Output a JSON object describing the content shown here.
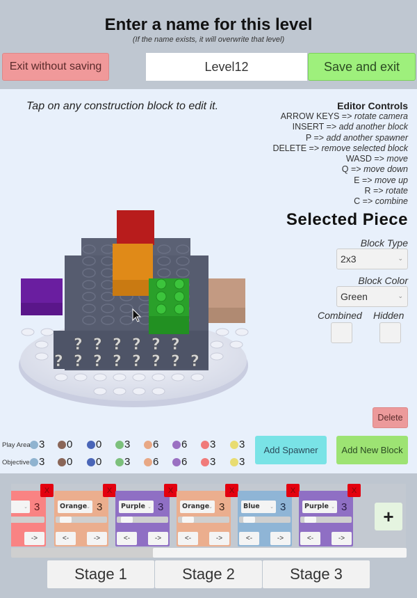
{
  "header": {
    "title": "Enter a name for this level",
    "subtitle": "(If the name exists, it will overwrite that level)",
    "exit_label": "Exit without saving",
    "level_name": "Level12",
    "save_label": "Save and exit"
  },
  "hint": "Tap on any construction block to edit it.",
  "controls": {
    "title": "Editor Controls",
    "items": [
      {
        "key": "ARROW KEYS =>",
        "action": "rotate camera"
      },
      {
        "key": "INSERT  =>",
        "action": "add another block"
      },
      {
        "key": "P =>",
        "action": "add another spawner"
      },
      {
        "key": "DELETE =>",
        "action": "remove selected block"
      },
      {
        "key": "WASD =>",
        "action": "move"
      },
      {
        "key": "Q =>",
        "action": "move down"
      },
      {
        "key": "E =>",
        "action": "move up"
      },
      {
        "key": "R =>",
        "action": "rotate"
      },
      {
        "key": "C =>",
        "action": "combine"
      }
    ]
  },
  "selected_piece": {
    "title": "Selected Piece",
    "block_type_label": "Block Type",
    "block_type": "2x3",
    "block_color_label": "Block Color",
    "block_color": "Green",
    "combined_label": "Combined",
    "hidden_label": "Hidden",
    "combined": false,
    "hidden": false
  },
  "buttons": {
    "delete": "Delete",
    "add_spawner": "Add Spawner",
    "add_new_block": "Add New Block",
    "add_stage_spawner": "+"
  },
  "counts": {
    "colors": [
      "#8fb3d0",
      "#8a6658",
      "#4a66b8",
      "#7cc07c",
      "#e8a885",
      "#9a70c2",
      "#f07a7a",
      "#e8dc72"
    ],
    "play_area": {
      "label": "Play Area",
      "values": [
        "3",
        "0",
        "0",
        "3",
        "6",
        "6",
        "3",
        "3"
      ]
    },
    "objectives": {
      "label": "Objectives",
      "values": [
        "3",
        "0",
        "0",
        "3",
        "6",
        "6",
        "3",
        "3"
      ]
    }
  },
  "spawners": [
    {
      "color_name": "",
      "count": "3",
      "bg": "#f98383",
      "num_color": "#5a1a1a",
      "prev": "",
      "next": "->",
      "progress": 0
    },
    {
      "color_name": "Orange",
      "count": "3",
      "bg": "#ebae8e",
      "num_color": "#3a2418",
      "prev": "<-",
      "next": "->",
      "progress": 0.1
    },
    {
      "color_name": "Purple",
      "count": "3",
      "bg": "#8f6fc4",
      "num_color": "#2a1a44",
      "prev": "<-",
      "next": "->",
      "progress": 0.1
    },
    {
      "color_name": "Orange",
      "count": "3",
      "bg": "#ebae8e",
      "num_color": "#3a2418",
      "prev": "<-",
      "next": "->",
      "progress": 0.1
    },
    {
      "color_name": "Blue",
      "count": "3",
      "bg": "#8fb5d6",
      "num_color": "#1a2a44",
      "prev": "<-",
      "next": "->",
      "progress": 0.1
    },
    {
      "color_name": "Purple",
      "count": "3",
      "bg": "#8f6fc4",
      "num_color": "#2a1a44",
      "prev": "<-",
      "next": "->",
      "progress": 0.1
    }
  ],
  "remove_label": "X",
  "spawner_scroll": 0.36,
  "stages": [
    "Stage 1",
    "Stage 2",
    "Stage 3"
  ],
  "scene": {
    "question_mark": "?"
  }
}
